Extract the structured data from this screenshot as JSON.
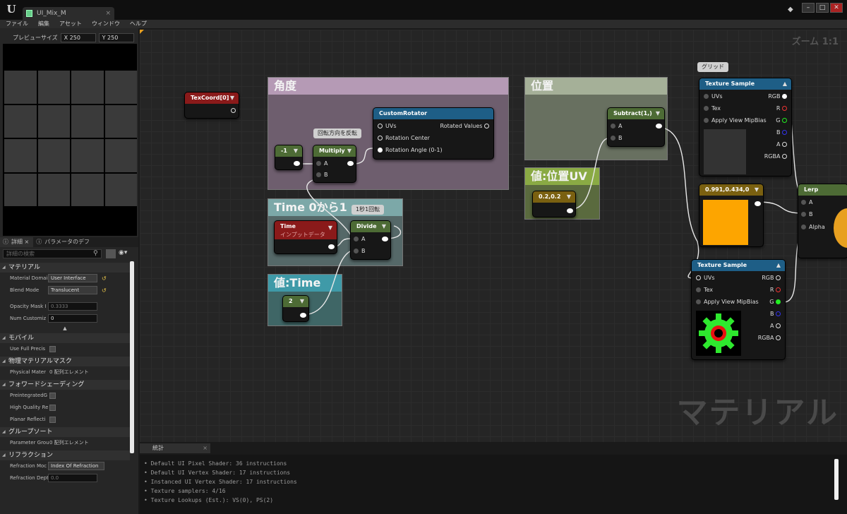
{
  "window": {
    "tab_title": "UI_Mix_M"
  },
  "menu": [
    "ファイル",
    "編集",
    "アセット",
    "ウィンドウ",
    "ヘルプ"
  ],
  "preview": {
    "size_label": "プレビューサイズ",
    "x_label": "X",
    "x_value": "250",
    "y_label": "Y",
    "y_value": "250"
  },
  "panel_tabs": {
    "details": "詳細",
    "params": "パラメータのデフ"
  },
  "search_placeholder": "詳細の検索",
  "sections": {
    "material": "マテリアル",
    "mobile": "モバイル",
    "phys": "物理マテリアルマスク",
    "forward": "フォワードシェーディング",
    "group": "グループソート",
    "refraction": "リフラクション"
  },
  "props": {
    "material_domain_label": "Material Domai",
    "material_domain_value": "User Interface",
    "blend_mode_label": "Blend Mode",
    "blend_mode_value": "Translucent",
    "opacity_mask_label": "Opacity Mask I",
    "opacity_mask_value": "0.3333",
    "num_custom_label": "Num Customiz",
    "num_custom_value": "0",
    "use_full_label": "Use Full Precis",
    "physical_label": "Physical Mater",
    "physical_value": "0 配列エレメント",
    "preintegrated_label": "PreintegratedG",
    "hq_label": "High Quality Re",
    "planar_label": "Planar Reflecti",
    "param_group_label": "Parameter Grou",
    "param_group_value": "0 配列エレメント",
    "refraction_mode_label": "Refraction Moc",
    "refraction_mode_value": "Index Of Refraction",
    "refraction_depth_label": "Refraction Dept",
    "refraction_depth_value": "0.0"
  },
  "canvas": {
    "zoom": "ズーム 1:1",
    "watermark": "マテリアル"
  },
  "comments": {
    "angle": "角度",
    "position": "位置",
    "time": "Time 0から1",
    "val_pos_uv": "値:位置UV",
    "val_time": "値:Time"
  },
  "bubbles": {
    "flip": "回転方向を反転",
    "onesec": "1秒1回転",
    "grid": "グリッド"
  },
  "nodes": {
    "texcoord": "TexCoord[0]",
    "neg1": "-1",
    "multiply": "Multiply",
    "customrotator": "CustomRotator",
    "uvs": "UVs",
    "rotated_values": "Rotated Values",
    "rotation_center": "Rotation Center",
    "rotation_angle": "Rotation Angle (0-1)",
    "subtract": "Subtract(1,)",
    "time": "Time",
    "time_sub": "インプットデータ",
    "divide": "Divide",
    "two": "2",
    "uv_const": "0.2,0.2",
    "color_const": "0.991,0.434,0",
    "texsample1": "Texture Sample",
    "texsample2": "Texture Sample",
    "lerp": "Lerp",
    "a": "A",
    "b": "B",
    "alpha": "Alpha",
    "tex": "Tex",
    "apply_mip": "Apply View MipBias",
    "rgb": "RGB",
    "r": "R",
    "g": "G",
    "bb": "B",
    "aa": "A",
    "rgba": "RGBA"
  },
  "stats": {
    "tab": "統計",
    "lines": [
      "Default UI Pixel Shader: 36 instructions",
      "Default UI Vertex Shader: 17 instructions",
      "Instanced UI Vertex Shader: 17 instructions",
      "Texture samplers: 4/16",
      "Texture Lookups (Est.): VS(0), PS(2)"
    ]
  },
  "colors": {
    "orange": "#fd6e00",
    "texture_header": "#1e5e86",
    "red_header": "#8a1a1a",
    "green_header": "#4d6b35",
    "gold_header": "#7a6010"
  }
}
